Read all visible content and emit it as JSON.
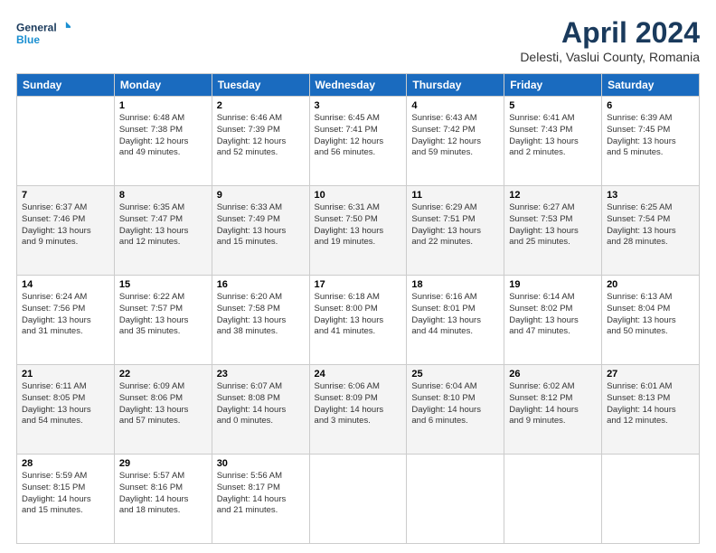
{
  "logo": {
    "line1": "General",
    "line2": "Blue"
  },
  "title": "April 2024",
  "subtitle": "Delesti, Vaslui County, Romania",
  "days_of_week": [
    "Sunday",
    "Monday",
    "Tuesday",
    "Wednesday",
    "Thursday",
    "Friday",
    "Saturday"
  ],
  "weeks": [
    [
      {
        "day": "",
        "info": ""
      },
      {
        "day": "1",
        "info": "Sunrise: 6:48 AM\nSunset: 7:38 PM\nDaylight: 12 hours\nand 49 minutes."
      },
      {
        "day": "2",
        "info": "Sunrise: 6:46 AM\nSunset: 7:39 PM\nDaylight: 12 hours\nand 52 minutes."
      },
      {
        "day": "3",
        "info": "Sunrise: 6:45 AM\nSunset: 7:41 PM\nDaylight: 12 hours\nand 56 minutes."
      },
      {
        "day": "4",
        "info": "Sunrise: 6:43 AM\nSunset: 7:42 PM\nDaylight: 12 hours\nand 59 minutes."
      },
      {
        "day": "5",
        "info": "Sunrise: 6:41 AM\nSunset: 7:43 PM\nDaylight: 13 hours\nand 2 minutes."
      },
      {
        "day": "6",
        "info": "Sunrise: 6:39 AM\nSunset: 7:45 PM\nDaylight: 13 hours\nand 5 minutes."
      }
    ],
    [
      {
        "day": "7",
        "info": "Sunrise: 6:37 AM\nSunset: 7:46 PM\nDaylight: 13 hours\nand 9 minutes."
      },
      {
        "day": "8",
        "info": "Sunrise: 6:35 AM\nSunset: 7:47 PM\nDaylight: 13 hours\nand 12 minutes."
      },
      {
        "day": "9",
        "info": "Sunrise: 6:33 AM\nSunset: 7:49 PM\nDaylight: 13 hours\nand 15 minutes."
      },
      {
        "day": "10",
        "info": "Sunrise: 6:31 AM\nSunset: 7:50 PM\nDaylight: 13 hours\nand 19 minutes."
      },
      {
        "day": "11",
        "info": "Sunrise: 6:29 AM\nSunset: 7:51 PM\nDaylight: 13 hours\nand 22 minutes."
      },
      {
        "day": "12",
        "info": "Sunrise: 6:27 AM\nSunset: 7:53 PM\nDaylight: 13 hours\nand 25 minutes."
      },
      {
        "day": "13",
        "info": "Sunrise: 6:25 AM\nSunset: 7:54 PM\nDaylight: 13 hours\nand 28 minutes."
      }
    ],
    [
      {
        "day": "14",
        "info": "Sunrise: 6:24 AM\nSunset: 7:56 PM\nDaylight: 13 hours\nand 31 minutes."
      },
      {
        "day": "15",
        "info": "Sunrise: 6:22 AM\nSunset: 7:57 PM\nDaylight: 13 hours\nand 35 minutes."
      },
      {
        "day": "16",
        "info": "Sunrise: 6:20 AM\nSunset: 7:58 PM\nDaylight: 13 hours\nand 38 minutes."
      },
      {
        "day": "17",
        "info": "Sunrise: 6:18 AM\nSunset: 8:00 PM\nDaylight: 13 hours\nand 41 minutes."
      },
      {
        "day": "18",
        "info": "Sunrise: 6:16 AM\nSunset: 8:01 PM\nDaylight: 13 hours\nand 44 minutes."
      },
      {
        "day": "19",
        "info": "Sunrise: 6:14 AM\nSunset: 8:02 PM\nDaylight: 13 hours\nand 47 minutes."
      },
      {
        "day": "20",
        "info": "Sunrise: 6:13 AM\nSunset: 8:04 PM\nDaylight: 13 hours\nand 50 minutes."
      }
    ],
    [
      {
        "day": "21",
        "info": "Sunrise: 6:11 AM\nSunset: 8:05 PM\nDaylight: 13 hours\nand 54 minutes."
      },
      {
        "day": "22",
        "info": "Sunrise: 6:09 AM\nSunset: 8:06 PM\nDaylight: 13 hours\nand 57 minutes."
      },
      {
        "day": "23",
        "info": "Sunrise: 6:07 AM\nSunset: 8:08 PM\nDaylight: 14 hours\nand 0 minutes."
      },
      {
        "day": "24",
        "info": "Sunrise: 6:06 AM\nSunset: 8:09 PM\nDaylight: 14 hours\nand 3 minutes."
      },
      {
        "day": "25",
        "info": "Sunrise: 6:04 AM\nSunset: 8:10 PM\nDaylight: 14 hours\nand 6 minutes."
      },
      {
        "day": "26",
        "info": "Sunrise: 6:02 AM\nSunset: 8:12 PM\nDaylight: 14 hours\nand 9 minutes."
      },
      {
        "day": "27",
        "info": "Sunrise: 6:01 AM\nSunset: 8:13 PM\nDaylight: 14 hours\nand 12 minutes."
      }
    ],
    [
      {
        "day": "28",
        "info": "Sunrise: 5:59 AM\nSunset: 8:15 PM\nDaylight: 14 hours\nand 15 minutes."
      },
      {
        "day": "29",
        "info": "Sunrise: 5:57 AM\nSunset: 8:16 PM\nDaylight: 14 hours\nand 18 minutes."
      },
      {
        "day": "30",
        "info": "Sunrise: 5:56 AM\nSunset: 8:17 PM\nDaylight: 14 hours\nand 21 minutes."
      },
      {
        "day": "",
        "info": ""
      },
      {
        "day": "",
        "info": ""
      },
      {
        "day": "",
        "info": ""
      },
      {
        "day": "",
        "info": ""
      }
    ]
  ]
}
